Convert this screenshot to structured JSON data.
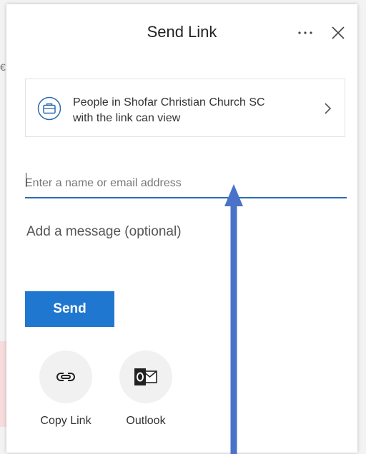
{
  "backdrop": {
    "edge_glyph": "€"
  },
  "dialog": {
    "title": "Send Link",
    "more_icon": "more-horizontal-icon",
    "close_icon": "close-icon"
  },
  "permission": {
    "line1": "People in Shofar Christian Church SC",
    "line2": "with the link can view",
    "icon": "briefcase-icon",
    "chevron": "chevron-right-icon"
  },
  "recipient_field": {
    "value": "",
    "placeholder": "Enter a name or email address"
  },
  "message_field": {
    "value": "",
    "placeholder": "Add a message (optional)"
  },
  "send_label": "Send",
  "share_options": [
    {
      "label": "Copy Link",
      "icon": "link-icon"
    },
    {
      "label": "Outlook",
      "icon": "outlook-icon"
    }
  ],
  "colors": {
    "accent": "#1f77d0",
    "annotation_arrow": "#4a72c8"
  }
}
